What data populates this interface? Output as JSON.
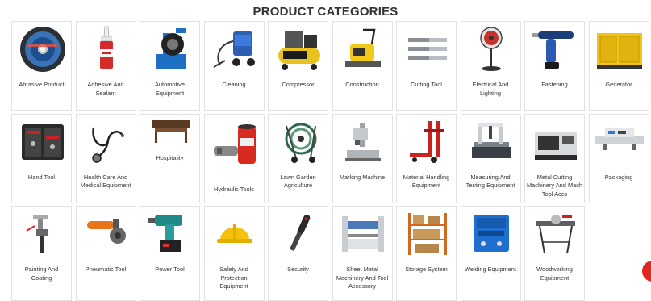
{
  "page": {
    "title": "PRODUCT CATEGORIES"
  },
  "categories": [
    {
      "label": "Abrasive Product",
      "icon": "abrasive-disc-icon"
    },
    {
      "label": "Adhesive And Sealant",
      "icon": "adhesive-bottle-icon"
    },
    {
      "label": "Automotive Equipment",
      "icon": "tyre-changer-icon"
    },
    {
      "label": "Cleaning",
      "icon": "pressure-washer-icon"
    },
    {
      "label": "Compressor",
      "icon": "air-compressor-icon"
    },
    {
      "label": "Construction",
      "icon": "plate-compactor-icon"
    },
    {
      "label": "Cutting Tool",
      "icon": "end-mill-icon"
    },
    {
      "label": "Electrical And Lighting",
      "icon": "stand-fan-icon"
    },
    {
      "label": "Fastening",
      "icon": "rivet-gun-icon"
    },
    {
      "label": "Generator",
      "icon": "generator-icon"
    },
    {
      "label": "Hand Tool",
      "icon": "tool-case-icon"
    },
    {
      "label": "Health Care And Medical Equipment",
      "icon": "stethoscope-icon"
    },
    {
      "label": "Hospitality",
      "icon": "coffee-table-icon"
    },
    {
      "label": "Hydraulic Tools",
      "icon": "hydraulic-cylinder-icon"
    },
    {
      "label": "Lawn Garden Agriculture",
      "icon": "hose-reel-icon"
    },
    {
      "label": "Marking Machine",
      "icon": "marking-machine-icon"
    },
    {
      "label": "Material Handling Equipment",
      "icon": "hand-truck-icon"
    },
    {
      "label": "Measuring And Testing Equipment",
      "icon": "cmm-machine-icon"
    },
    {
      "label": "Metal Cutting Machinery And Mach Tool Accs",
      "icon": "cnc-lathe-icon"
    },
    {
      "label": "Packaging",
      "icon": "band-sealer-icon"
    },
    {
      "label": "Painting And Coating",
      "icon": "spray-gun-icon"
    },
    {
      "label": "Pneumatic Tool",
      "icon": "angle-grinder-icon"
    },
    {
      "label": "Power Tool",
      "icon": "impact-driver-icon"
    },
    {
      "label": "Safety And Protection Equipment",
      "icon": "hard-hat-icon"
    },
    {
      "label": "Security",
      "icon": "metal-detector-icon"
    },
    {
      "label": "Sheet Metal Machinery And Tool Accessory",
      "icon": "press-brake-icon"
    },
    {
      "label": "Storage System",
      "icon": "storage-rack-icon"
    },
    {
      "label": "Welding Equipment",
      "icon": "welding-machine-icon"
    },
    {
      "label": "Woodworking Equipment",
      "icon": "table-saw-icon"
    }
  ],
  "colors": {
    "title": "#333333",
    "border": "#e2e2e2",
    "chat": "#e0261b"
  }
}
